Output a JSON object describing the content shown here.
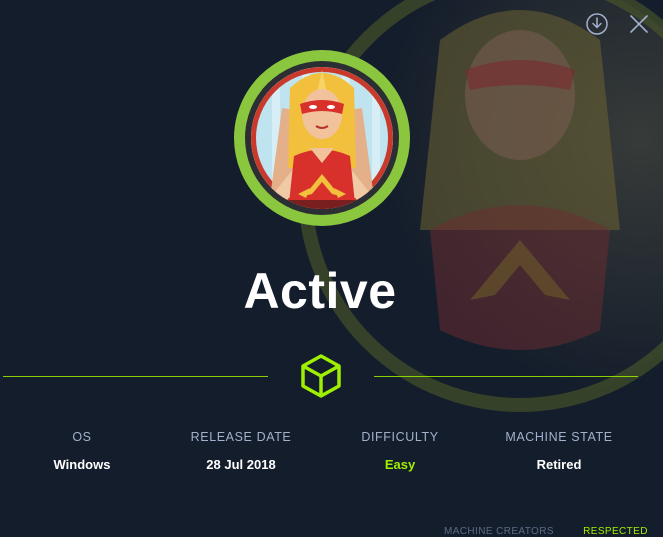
{
  "machine": {
    "name": "Active"
  },
  "actions": {
    "download_icon": "download-icon",
    "close_icon": "close-icon"
  },
  "stats": [
    {
      "label": "OS",
      "value": "Windows"
    },
    {
      "label": "RELEASE DATE",
      "value": "28 Jul 2018"
    },
    {
      "label": "DIFFICULTY",
      "value": "Easy"
    },
    {
      "label": "MACHINE STATE",
      "value": "Retired"
    }
  ],
  "footer": {
    "creators_label": "MACHINE CREATORS",
    "respected_label": "RESPECTED"
  },
  "colors": {
    "accent": "#9fef00",
    "background": "#141d2b",
    "label": "#a4b1cd"
  }
}
